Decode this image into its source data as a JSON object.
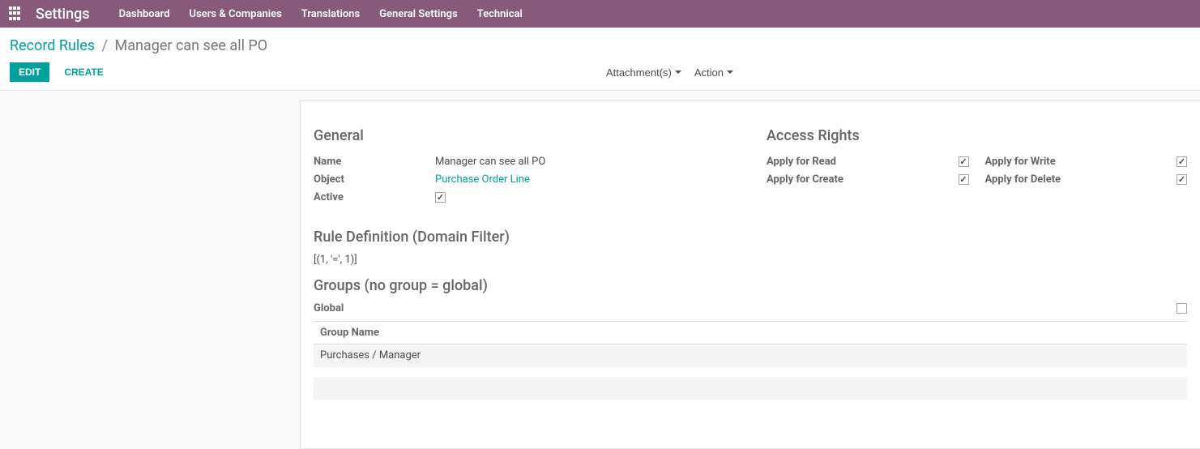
{
  "navbar": {
    "brand": "Settings",
    "menu": [
      "Dashboard",
      "Users & Companies",
      "Translations",
      "General Settings",
      "Technical"
    ]
  },
  "breadcrumb": {
    "parent": "Record Rules",
    "current": "Manager can see all PO"
  },
  "buttons": {
    "edit": "EDIT",
    "create": "CREATE",
    "attachments": "Attachment(s)",
    "action": "Action"
  },
  "sections": {
    "general": "General",
    "access": "Access Rights",
    "rule_def": "Rule Definition (Domain Filter)",
    "groups": "Groups (no group = global)"
  },
  "fields": {
    "name_label": "Name",
    "name_value": "Manager can see all PO",
    "object_label": "Object",
    "object_value": "Purchase Order Line",
    "active_label": "Active",
    "active_checked": true
  },
  "access": {
    "read_label": "Apply for Read",
    "read_checked": true,
    "create_label": "Apply for Create",
    "create_checked": true,
    "write_label": "Apply for Write",
    "write_checked": true,
    "delete_label": "Apply for Delete",
    "delete_checked": true
  },
  "domain_filter": "[(1, '=', 1)]",
  "global": {
    "label": "Global",
    "checked": false
  },
  "groups_table": {
    "header": "Group Name",
    "rows": [
      "Purchases / Manager"
    ]
  }
}
